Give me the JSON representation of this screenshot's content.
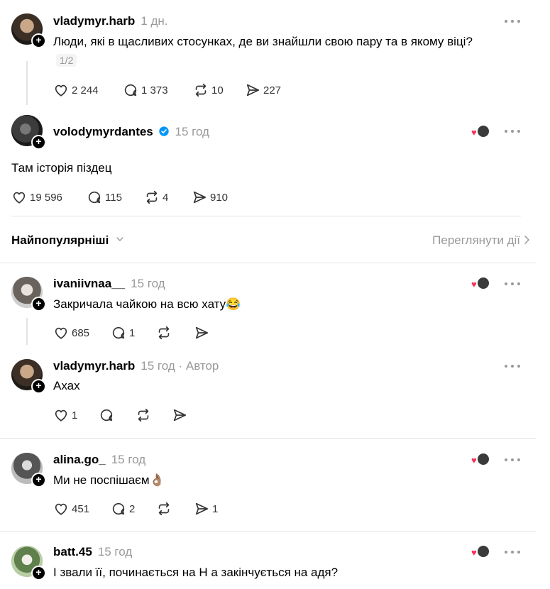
{
  "posts": [
    {
      "username": "vladymyr.harb",
      "time": "1 дн.",
      "text": "Люди, які в щасливих стосунках, де ви знайшли свою пару та в якому віці?",
      "pager": "1/2",
      "likes": "2 244",
      "comments": "1 373",
      "reposts": "10",
      "shares": "227"
    },
    {
      "username": "volodymyrdantes",
      "verified": true,
      "time": "15 год",
      "text": "Там історія піздец",
      "likes": "19 596",
      "comments": "115",
      "reposts": "4",
      "shares": "910"
    }
  ],
  "sort": {
    "label": "Найпопулярніші",
    "activity_link": "Переглянути дії"
  },
  "replies": [
    {
      "username": "ivaniivnaa__",
      "time": "15 год",
      "text": "Закричала чайкою на всю хату😂",
      "likes": "685",
      "comments": "1",
      "reposts": "",
      "shares": ""
    },
    {
      "username": "vladymyr.harb",
      "time": "15 год",
      "author_badge": "· Автор",
      "text": "Ахах",
      "likes": "1",
      "comments": "",
      "reposts": "",
      "shares": ""
    },
    {
      "username": "alina.go_",
      "time": "15 год",
      "text": "Ми не поспішаєм👌🏽",
      "likes": "451",
      "comments": "2",
      "reposts": "",
      "shares": "1"
    },
    {
      "username": "batt.45",
      "time": "15 год",
      "text": "І звали її, починається на Н а закінчується на адя?"
    }
  ],
  "colors": {
    "verified_badge": "#0095f6",
    "liked_heart": "#ff2d55",
    "muted_text": "#999999",
    "divider": "#e3e3e3"
  },
  "icons": [
    "heart-icon",
    "comment-icon",
    "repost-icon",
    "share-icon",
    "more-icon",
    "follow-plus-icon",
    "verified-icon",
    "chevron-down-icon",
    "chevron-right-icon"
  ]
}
